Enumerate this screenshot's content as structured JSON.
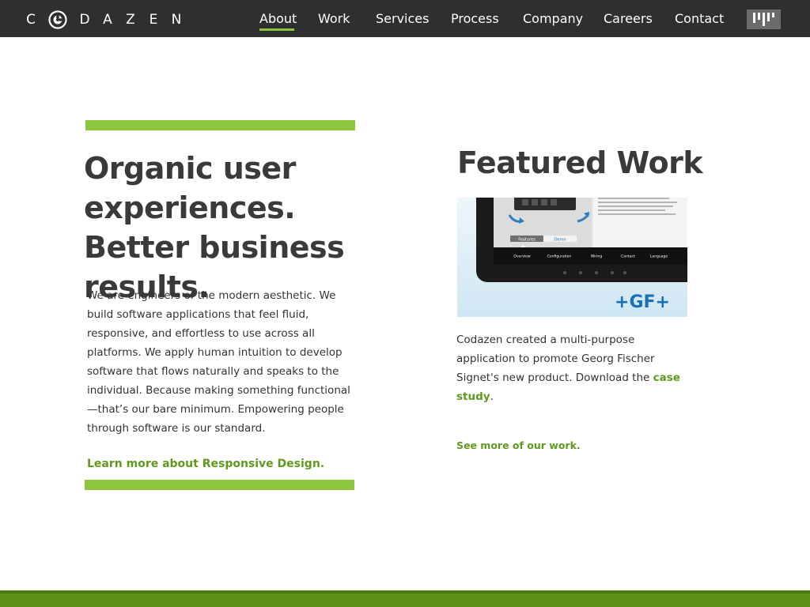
{
  "brand": {
    "logo_letters": [
      "C",
      "D",
      "A",
      "Z",
      "E",
      "N"
    ],
    "logo_icon": "compass-gear-icon"
  },
  "nav": {
    "items": [
      {
        "label": "About",
        "active": true
      },
      {
        "label": "Work",
        "active": false
      },
      {
        "label": "Services",
        "active": false
      },
      {
        "label": "Process",
        "active": false
      },
      {
        "label": "Company",
        "active": false
      },
      {
        "label": "Careers",
        "active": false
      },
      {
        "label": "Contact",
        "active": false
      }
    ],
    "menu_icon": "bars-icon"
  },
  "intro": {
    "headline": "Organic user experiences. Better business results.",
    "body": "We are engineers of the modern aesthetic. We build software applications that feel fluid, responsive, and effortless to use across all platforms. We apply human intuition to develop software that flows naturally and speaks to the individual. Because making something functional—that’s our bare minimum. Empowering people through software is our standard.",
    "link_label": "Learn more about Responsive Design."
  },
  "featured": {
    "title": "Featured Work",
    "desc_prefix": "Codazen created a multi-purpose application to promote Georg Fischer Signet's new product. Download the ",
    "case_link": "case study",
    "desc_suffix": ".",
    "see_more": "See more of our work.",
    "screenshot": {
      "tabs": [
        "Features",
        "Demo"
      ],
      "menu": [
        "Overview",
        "Configuration",
        "Wiring",
        "Contact",
        "Language"
      ],
      "logo_text": "+GF+"
    }
  },
  "colors": {
    "accent": "#8cc63f",
    "link": "#5f9a1c",
    "nav_bg": "#2f2f2f",
    "footer": "#5a8f16"
  }
}
